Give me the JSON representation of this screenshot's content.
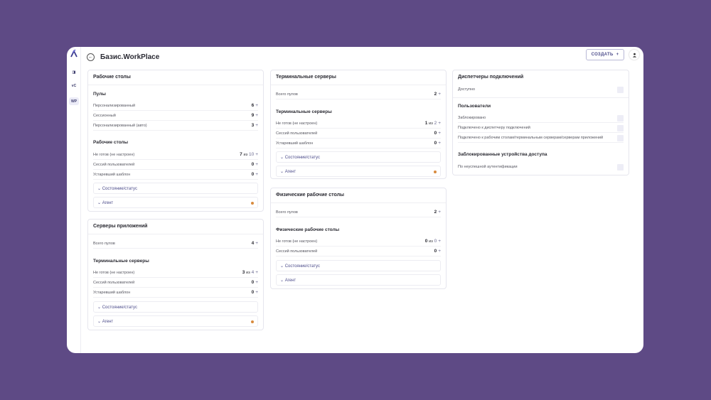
{
  "header": {
    "title": "Базис.WorkPlace",
    "create_label": "СОЗДАТЬ",
    "create_plus": "+"
  },
  "rail": {
    "items": [
      {
        "label": "◨"
      },
      {
        "label": "vC"
      },
      {
        "label": "WP"
      }
    ]
  },
  "cards": {
    "desktops": {
      "title": "Рабочие столы",
      "pools_title": "Пулы",
      "pools": [
        {
          "label": "Персонализированный",
          "value": "6"
        },
        {
          "label": "Сессионный",
          "value": "9"
        },
        {
          "label": "Персонализированный (авто)",
          "value": "3"
        }
      ],
      "desktops_title": "Рабочие столы",
      "rows": [
        {
          "label": "Не готов (не настроен)",
          "value": "7",
          "sep": "из",
          "total": "10"
        },
        {
          "label": "Сессий пользователей",
          "value": "0"
        },
        {
          "label": "Устаревший шаблон",
          "value": "0"
        }
      ],
      "status_label": "Состояние/статус",
      "agent_label": "Агент"
    },
    "app_servers": {
      "title": "Серверы приложений",
      "total_row": {
        "label": "Всего пулов",
        "value": "4"
      },
      "term_title": "Терминальные серверы",
      "rows": [
        {
          "label": "Не готов (не настроен)",
          "value": "3",
          "sep": "из",
          "total": "4"
        },
        {
          "label": "Сессий пользователей",
          "value": "0"
        },
        {
          "label": "Устаревший шаблон",
          "value": "0"
        }
      ],
      "status_label": "Состояние/статус",
      "agent_label": "Агент"
    },
    "terminal": {
      "title": "Терминальные серверы",
      "total_row": {
        "label": "Всего пулов",
        "value": "2"
      },
      "sub_title": "Терминальные серверы",
      "rows": [
        {
          "label": "Не готов (не настроен)",
          "value": "1",
          "sep": "из",
          "total": "2"
        },
        {
          "label": "Сессий пользователей",
          "value": "0"
        },
        {
          "label": "Устаревший шаблон",
          "value": "0"
        }
      ],
      "status_label": "Состояние/статус",
      "agent_label": "Агент"
    },
    "physical": {
      "title": "Физические рабочие столы",
      "total_row": {
        "label": "Всего пулов",
        "value": "2"
      },
      "sub_title": "Физические рабочие столы",
      "rows": [
        {
          "label": "Не готов (не настроен)",
          "value": "0",
          "sep": "из",
          "total": "0"
        },
        {
          "label": "Сессий пользователей",
          "value": "0"
        }
      ],
      "status_label": "Состояние/статус",
      "agent_label": "Агент"
    },
    "brokers": {
      "title": "Диспетчеры подключений",
      "available_label": "Доступно",
      "users_title": "Пользователи",
      "users": [
        {
          "label": "Заблокировано"
        },
        {
          "label": "Подключено к диспетчеру подключений"
        },
        {
          "label": "Подключено к рабочим столам/терминальным серверам/серверам приложений"
        }
      ],
      "locked_title": "Заблокированные устройства доступа",
      "locked_row": {
        "label": "По неуспешной аутентификации"
      }
    }
  },
  "plus": "+",
  "chevron": "⌄"
}
